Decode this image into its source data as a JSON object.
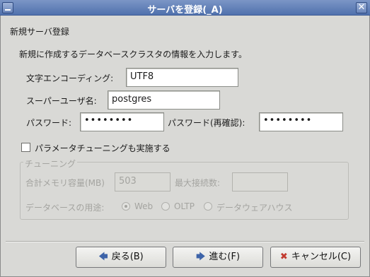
{
  "window": {
    "title": "サーバを登録(_A)",
    "close_glyph": "✕"
  },
  "section_title": "新規サーバ登録",
  "description": "新規に作成するデータベースクラスタの情報を入力します。",
  "fields": {
    "encoding_label": "文字エンコーディング:",
    "encoding_value": "UTF8",
    "superuser_label": "スーパーユーザ名:",
    "superuser_value": "postgres",
    "password_label": "パスワード:",
    "password_value": "••••••••",
    "password_confirm_label": "パスワード(再確認):",
    "password_confirm_value": "••••••••"
  },
  "tuning": {
    "checkbox_label": "パラメータチューニングも実施する",
    "checked": false,
    "group_label": "チューニング",
    "memory_label": "合計メモリ容量(MB)",
    "memory_value": "503",
    "maxconn_label": "最大接続数:",
    "maxconn_value": "",
    "usage_label": "データベースの用途:",
    "usage_options": [
      "Web",
      "OLTP",
      "データウェアハウス"
    ],
    "usage_selected": "Web"
  },
  "buttons": {
    "back": "戻る(B)",
    "forward": "進む(F)",
    "cancel": "キャンセル(C)"
  },
  "icons": {
    "back": "arrow-left-icon",
    "forward": "arrow-right-icon",
    "cancel": "cancel-x-icon"
  }
}
